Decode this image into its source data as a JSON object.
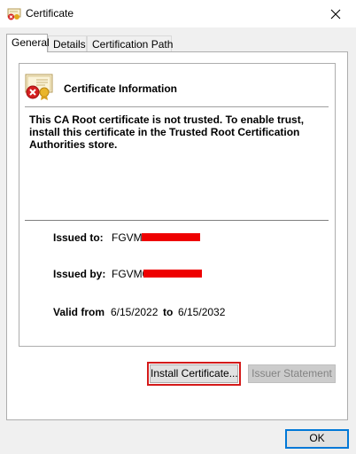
{
  "window": {
    "title": "Certificate",
    "close_glyph": "✕"
  },
  "tabs": [
    {
      "label": "General"
    },
    {
      "label": "Details"
    },
    {
      "label": "Certification Path"
    }
  ],
  "info": {
    "title": "Certificate Information",
    "message": "This CA Root certificate is not trusted. To enable trust, install this certificate in the Trusted Root Certification Authorities store."
  },
  "fields": {
    "issued_to_label": "Issued to:",
    "issued_to_value": "FGVM0",
    "issued_by_label": "Issued by:",
    "issued_by_value": "FGVM0",
    "valid_from_label": "Valid from",
    "valid_from_value": "6/15/2022",
    "valid_to_label": "to",
    "valid_to_value": "6/15/2032"
  },
  "buttons": {
    "install": "Install Certificate...",
    "issuer_statement": "Issuer Statement",
    "ok": "OK"
  },
  "colors": {
    "redaction": "#ee0000",
    "highlight": "#d41a1a",
    "accent": "#0078d7"
  },
  "icons": {
    "app": "certificate-error-icon",
    "main": "certificate-error-icon"
  }
}
